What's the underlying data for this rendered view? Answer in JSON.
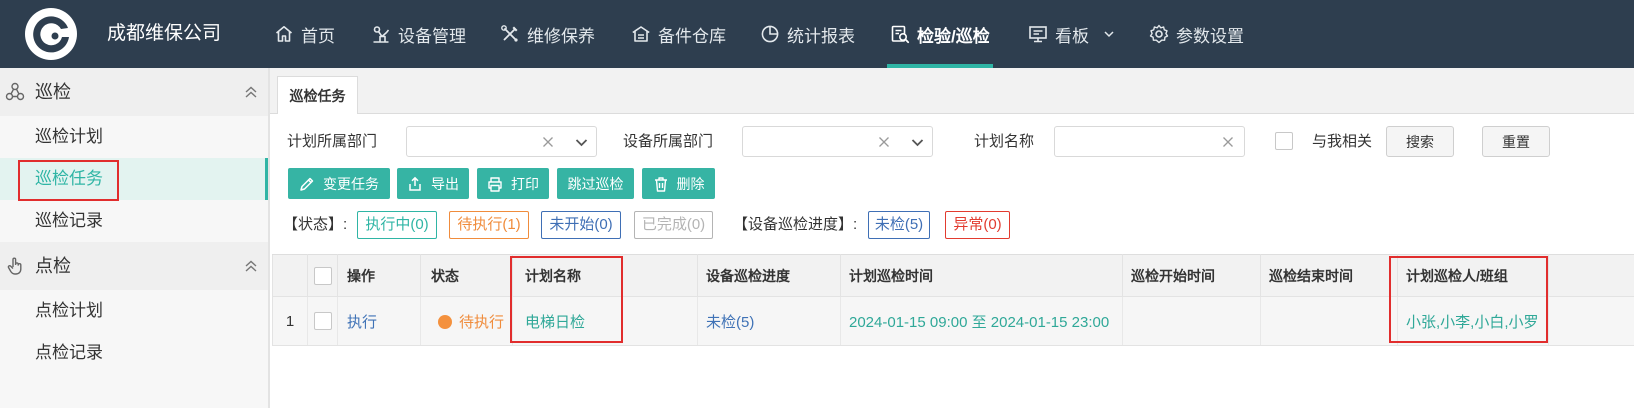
{
  "header": {
    "company": "成都维保公司",
    "nav": [
      {
        "label": "首页",
        "icon": "home-icon"
      },
      {
        "label": "设备管理",
        "icon": "equipment-icon"
      },
      {
        "label": "维修保养",
        "icon": "tools-icon"
      },
      {
        "label": "备件仓库",
        "icon": "warehouse-icon"
      },
      {
        "label": "统计报表",
        "icon": "pie-chart-icon"
      },
      {
        "label": "检验/巡检",
        "icon": "inspection-icon",
        "active": true
      },
      {
        "label": "看板",
        "icon": "monitor-icon",
        "dropdown": true
      },
      {
        "label": "参数设置",
        "icon": "gear-icon"
      }
    ]
  },
  "sidebar": {
    "groups": [
      {
        "title": "巡检",
        "icon": "network-icon",
        "expanded": true,
        "items": [
          {
            "label": "巡检计划"
          },
          {
            "label": "巡检任务",
            "active": true
          },
          {
            "label": "巡检记录"
          }
        ]
      },
      {
        "title": "点检",
        "icon": "hand-pointer-icon",
        "expanded": true,
        "items": [
          {
            "label": "点检计划"
          },
          {
            "label": "点检记录"
          }
        ]
      }
    ]
  },
  "tabs": [
    {
      "label": "巡检任务",
      "active": true
    }
  ],
  "filters": {
    "plan_dept_label": "计划所属部门",
    "plan_dept_value": "",
    "equip_dept_label": "设备所属部门",
    "equip_dept_value": "",
    "plan_name_label": "计划名称",
    "plan_name_value": "",
    "related_to_me_label": "与我相关",
    "related_to_me_checked": false,
    "search_label": "搜索",
    "reset_label": "重置"
  },
  "actions": [
    {
      "label": "变更任务",
      "icon": "edit-icon"
    },
    {
      "label": "导出",
      "icon": "export-icon"
    },
    {
      "label": "打印",
      "icon": "printer-icon"
    },
    {
      "label": "跳过巡检"
    },
    {
      "label": "删除",
      "icon": "trash-icon"
    }
  ],
  "status_filter": {
    "label": "【状态】:",
    "tags": [
      {
        "label": "执行中(0)",
        "color": "#2fb5a5"
      },
      {
        "label": "待执行(1)",
        "color": "#f08c3c"
      },
      {
        "label": "未开始(0)",
        "color": "#3f6fb5"
      },
      {
        "label": "已完成(0)",
        "color": "#b4b4b4"
      }
    ]
  },
  "progress_filter": {
    "label": "【设备巡检进度】:",
    "tags": [
      {
        "label": "未检(5)",
        "color": "#3f6fb5"
      },
      {
        "label": "异常(0)",
        "color": "#e23b2f"
      }
    ]
  },
  "table": {
    "columns": [
      "操作",
      "状态",
      "计划名称",
      "设备巡检进度",
      "计划巡检时间",
      "巡检开始时间",
      "巡检结束时间",
      "计划巡检人/班组"
    ],
    "rows": [
      {
        "index": "1",
        "checked": false,
        "action": "执行",
        "status": "待执行",
        "plan_name": "电梯日检",
        "progress": "未检(5)",
        "planned_time": "2024-01-15 09:00 至 2024-01-15 23:00",
        "start_time": "",
        "end_time": "",
        "inspectors": "小张,小李,小白,小罗"
      }
    ]
  },
  "theme": {
    "header_bg": "#2e3e4f",
    "accent": "#2fb5a5",
    "annotation": "#e12d2d"
  }
}
